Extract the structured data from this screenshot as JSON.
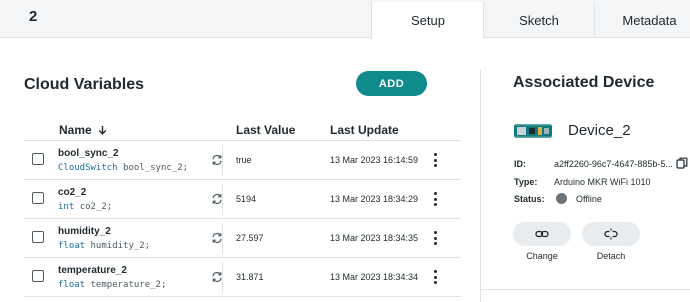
{
  "header": {
    "thing_name": "2",
    "tabs": [
      {
        "label": "Setup",
        "active": true
      },
      {
        "label": "Sketch",
        "active": false
      },
      {
        "label": "Metadata",
        "active": false
      }
    ]
  },
  "variables": {
    "title": "Cloud Variables",
    "add_label": "ADD",
    "columns": {
      "name": "Name",
      "last_value": "Last Value",
      "last_update": "Last Update"
    },
    "sort_icon": "arrow-down-icon",
    "rows": [
      {
        "name": "bool_sync_2",
        "type": "CloudSwitch",
        "decl": "bool_sync_2;",
        "value": "true",
        "updated": "13 Mar 2023 16:14:59"
      },
      {
        "name": "co2_2",
        "type": "int",
        "decl": "co2_2;",
        "value": "5194",
        "updated": "13 Mar 2023 18:34:29"
      },
      {
        "name": "humidity_2",
        "type": "float",
        "decl": "humidity_2;",
        "value": "27.597",
        "updated": "13 Mar 2023 18:34:35"
      },
      {
        "name": "temperature_2",
        "type": "float",
        "decl": "temperature_2;",
        "value": "31.871",
        "updated": "13 Mar 2023 18:34:34"
      }
    ]
  },
  "device": {
    "title": "Associated Device",
    "name": "Device_2",
    "id_label": "ID:",
    "id_value": "a2ff2260-96c7-4647-885b-5...",
    "type_label": "Type:",
    "type_value": "Arduino MKR WiFi 1010",
    "status_label": "Status:",
    "status_value": "Offline",
    "status_color": "#6b7378",
    "change_label": "Change",
    "detach_label": "Detach"
  },
  "colors": {
    "accent": "#0f8a8d"
  }
}
